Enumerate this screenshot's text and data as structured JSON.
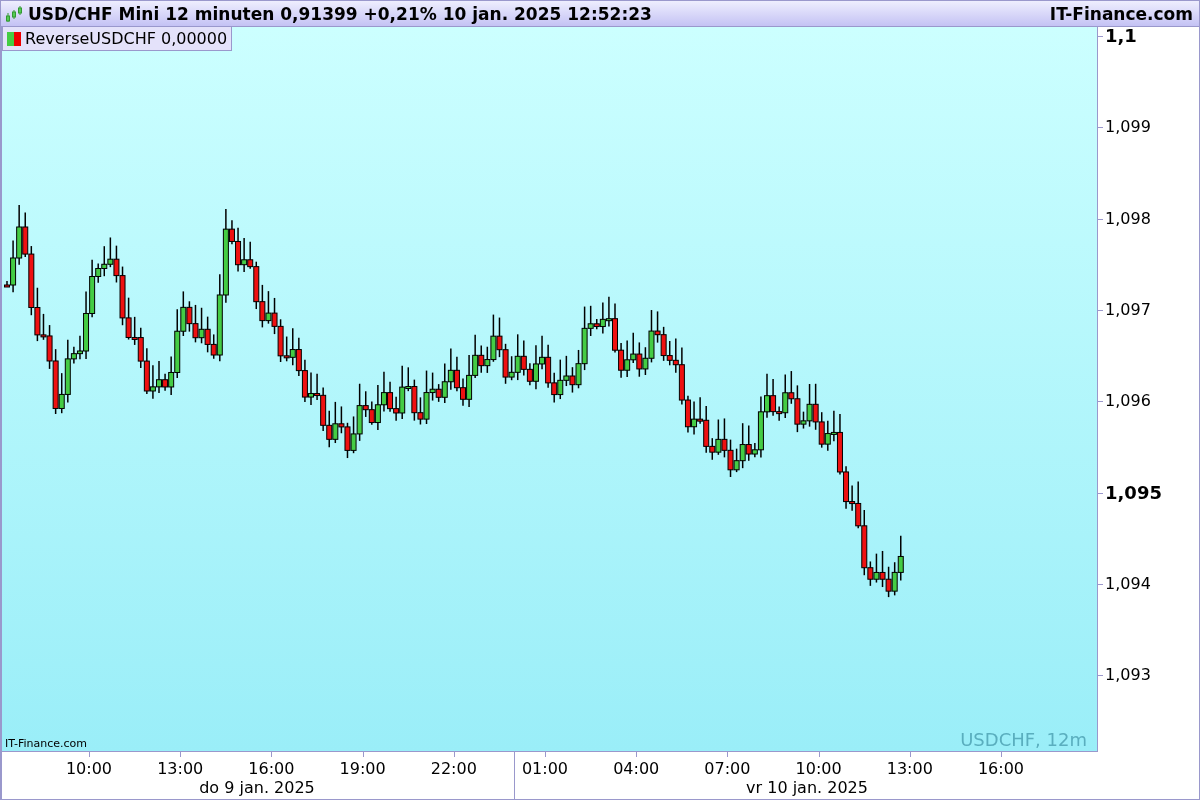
{
  "header": {
    "title": "USD/CHF Mini 12 minuten 0,91399 +0,21% 10 jan. 2025 12:52:23",
    "site": "IT-Finance.com"
  },
  "legend": {
    "label": "ReverseUSDCHF 0,00000"
  },
  "chart": {
    "credit": "IT-Finance.com",
    "caption": "USDCHF, 12m",
    "y_ticks": [
      {
        "label": "1,1",
        "major": true
      },
      {
        "label": "1,099",
        "major": false
      },
      {
        "label": "1,098",
        "major": false
      },
      {
        "label": "1,097",
        "major": false
      },
      {
        "label": "1,096",
        "major": false
      },
      {
        "label": "1,095",
        "major": true
      },
      {
        "label": "1,094",
        "major": false
      },
      {
        "label": "1,093",
        "major": false
      }
    ],
    "x_ticks": [
      "10:00",
      "13:00",
      "16:00",
      "19:00",
      "22:00",
      "01:00",
      "04:00",
      "07:00",
      "10:00",
      "13:00",
      "16:00"
    ],
    "dates": [
      "do 9 jan. 2025",
      "vr 10 jan. 2025"
    ]
  }
}
